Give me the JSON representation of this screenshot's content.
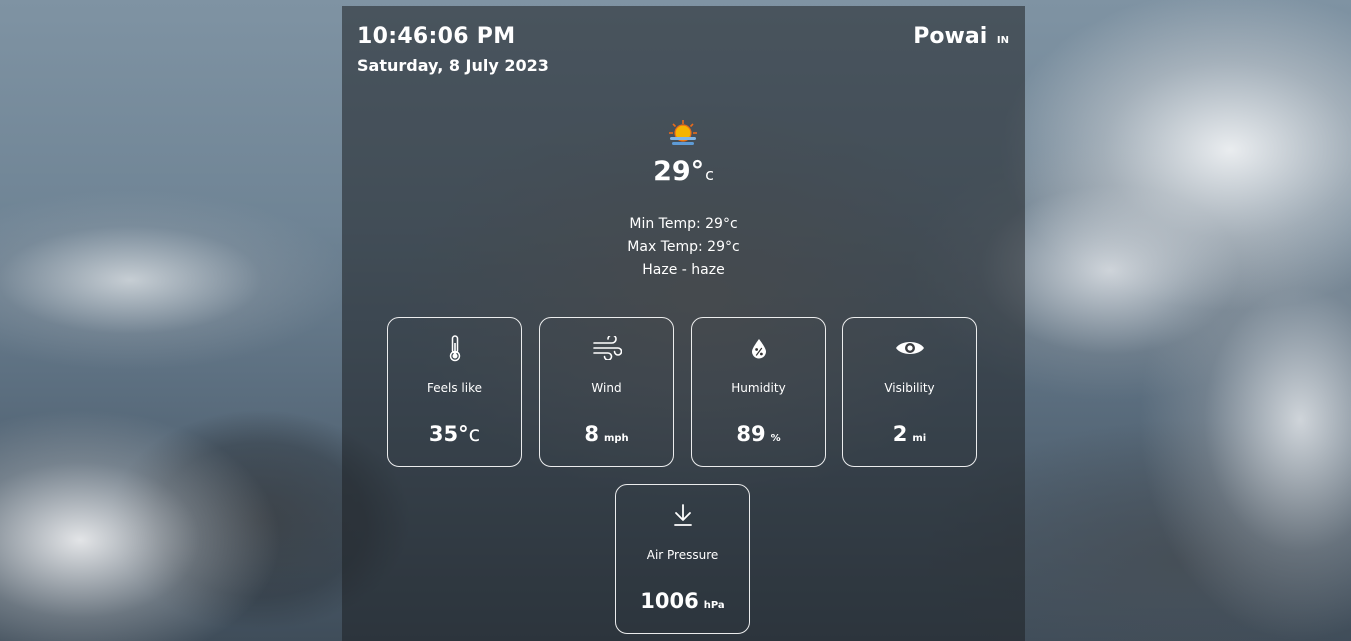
{
  "header": {
    "time": "10:46:06 PM",
    "date": "Saturday, 8 July 2023",
    "city": "Powai",
    "country": "IN"
  },
  "current": {
    "icon": "sun-behind-haze-icon",
    "temperature": "29°",
    "unit": "c",
    "min_temp": "Min Temp: 29°c",
    "max_temp": "Max Temp: 29°c",
    "description": "Haze - haze"
  },
  "cards": [
    {
      "label": "Feels like",
      "value": "35°",
      "unit": "c",
      "icon": "thermometer-icon"
    },
    {
      "label": "Wind",
      "value": "8",
      "unit": "mph",
      "icon": "wind-icon"
    },
    {
      "label": "Humidity",
      "value": "89",
      "unit": "%",
      "icon": "humidity-drop-icon"
    },
    {
      "label": "Visibility",
      "value": "2",
      "unit": "mi",
      "icon": "eye-icon"
    },
    {
      "label": "Air Pressure",
      "value": "1006",
      "unit": "hPa",
      "icon": "arrow-down-icon"
    }
  ],
  "colors": {
    "text": "#ffffff",
    "panel": "rgba(30,32,36,0.55)",
    "card_border": "#ffffff",
    "sun": "#f5b400"
  }
}
